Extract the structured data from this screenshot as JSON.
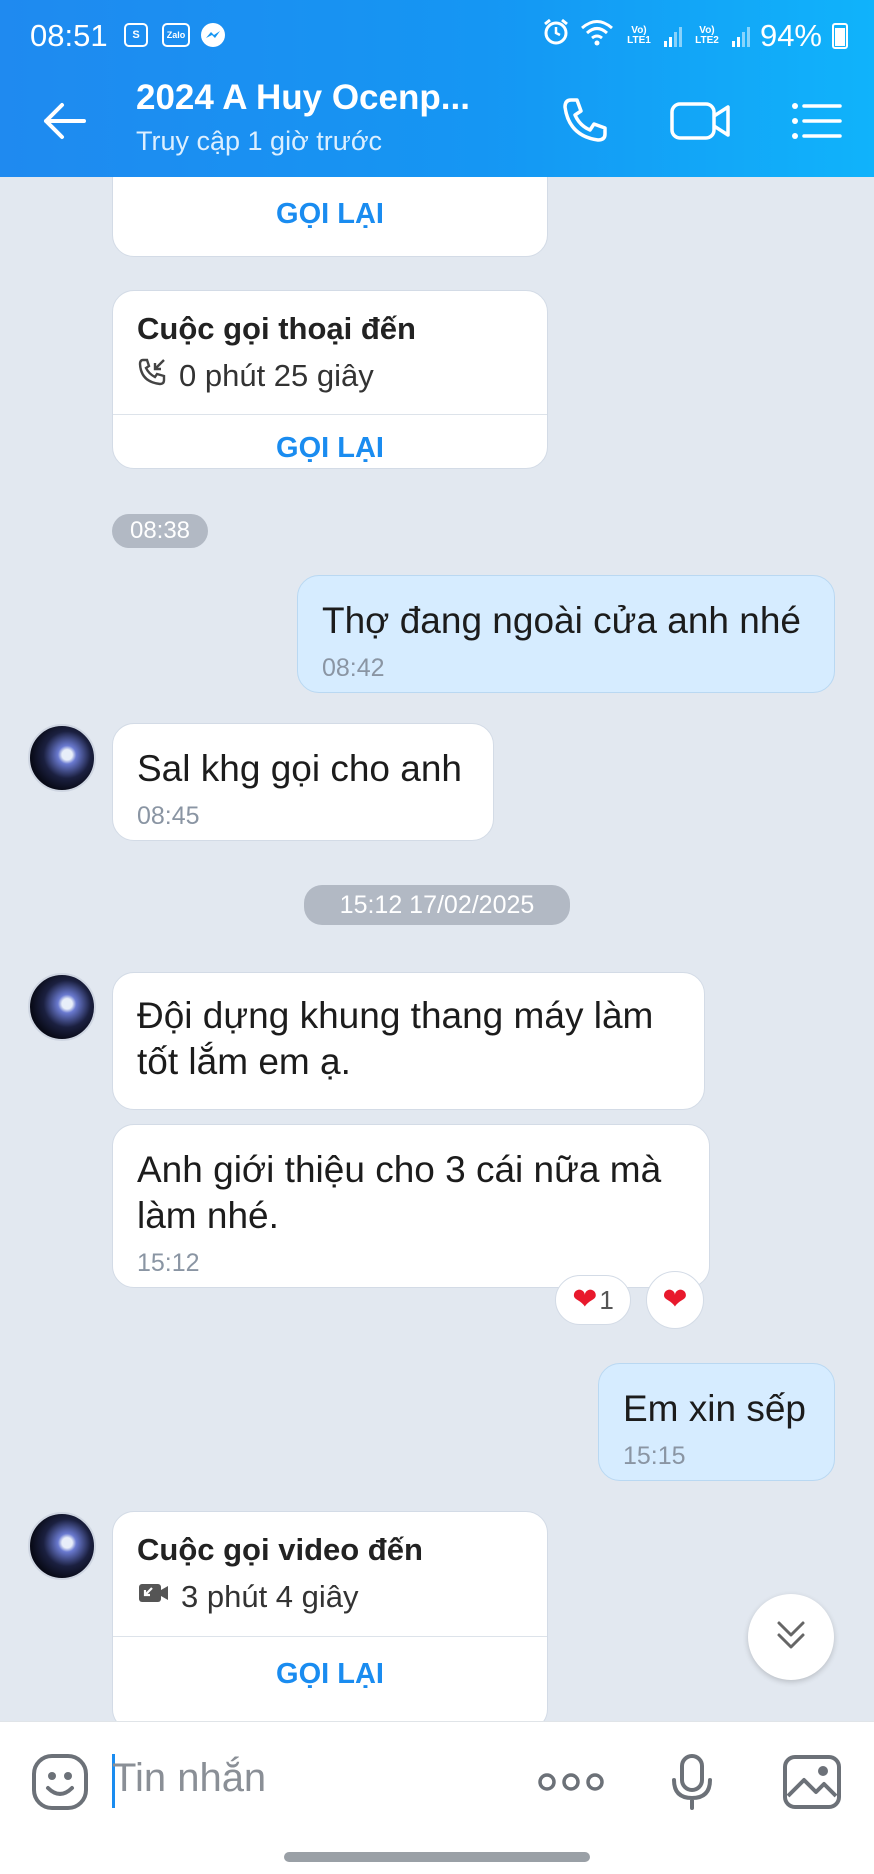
{
  "status_bar": {
    "time": "08:51",
    "app_icons": [
      "shopee-icon",
      "zalo-icon",
      "messenger-icon"
    ],
    "net1": "Vo) LTE1",
    "net2": "Vo) LTE2",
    "battery": "94%"
  },
  "header": {
    "title": "2024 A Huy Ocenp...",
    "subtitle": "Truy cập 1 giờ trước",
    "accent": "#1596f3"
  },
  "messages": {
    "call1": {
      "button": "GỌI LẠI"
    },
    "call2": {
      "title": "Cuộc gọi thoại đến",
      "duration": "0 phút 25 giây",
      "button": "GỌI LẠI"
    },
    "time_0838": "08:38",
    "out1": {
      "text": "Thợ đang ngoài cửa anh nhé",
      "time": "08:42"
    },
    "in1": {
      "text": "Sal khg gọi cho anh",
      "time": "08:45"
    },
    "date_sep": "15:12 17/02/2025",
    "in2": {
      "line1": "Đội dựng khung thang máy làm",
      "line2": "tốt lắm em ạ."
    },
    "in3": {
      "line1": "Anh giới thiệu cho 3 cái nữa mà",
      "line2": "làm nhé.",
      "time": "15:12",
      "reaction_count": "1"
    },
    "out2": {
      "text": "Em xin sếp",
      "time": "15:15"
    },
    "call3": {
      "title": "Cuộc gọi video đến",
      "duration": "3 phút 4 giây",
      "button": "GỌI LẠI"
    }
  },
  "input": {
    "placeholder": "Tin nhắn"
  }
}
